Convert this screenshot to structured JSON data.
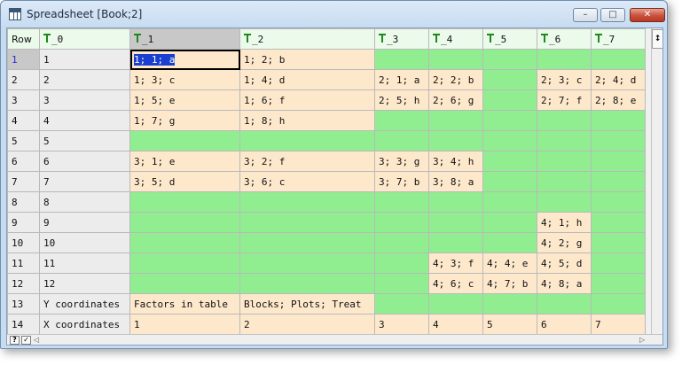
{
  "window": {
    "title": "Spreadsheet [Book;2]",
    "controls": {
      "minimize": "–",
      "maximize": "□",
      "close": "✕"
    }
  },
  "grid": {
    "corner_label": "Row",
    "columns": [
      "_0",
      "_1",
      "_2",
      "_3",
      "_4",
      "_5",
      "_6",
      "_7"
    ],
    "rows": [
      [
        "1",
        "1",
        "1; 1; a",
        "1; 2; b",
        "",
        "",
        "",
        "",
        ""
      ],
      [
        "2",
        "2",
        "1; 3; c",
        "1; 4; d",
        "2; 1; a",
        "2; 2; b",
        "",
        "2; 3; c",
        "2; 4; d"
      ],
      [
        "3",
        "3",
        "1; 5; e",
        "1; 6; f",
        "2; 5; h",
        "2; 6; g",
        "",
        "2; 7; f",
        "2; 8; e"
      ],
      [
        "4",
        "4",
        "1; 7; g",
        "1; 8; h",
        "",
        "",
        "",
        "",
        ""
      ],
      [
        "5",
        "5",
        "",
        "",
        "",
        "",
        "",
        "",
        ""
      ],
      [
        "6",
        "6",
        "3; 1; e",
        "3; 2; f",
        "3; 3; g",
        "3; 4; h",
        "",
        "",
        ""
      ],
      [
        "7",
        "7",
        "3; 5; d",
        "3; 6; c",
        "3; 7; b",
        "3; 8; a",
        "",
        "",
        ""
      ],
      [
        "8",
        "8",
        "",
        "",
        "",
        "",
        "",
        "",
        ""
      ],
      [
        "9",
        "9",
        "",
        "",
        "",
        "",
        "",
        "4; 1; h",
        ""
      ],
      [
        "10",
        "10",
        "",
        "",
        "",
        "",
        "",
        "4; 2; g",
        ""
      ],
      [
        "11",
        "11",
        "",
        "",
        "",
        "4; 3; f",
        "4; 4; e",
        "4; 5; d",
        ""
      ],
      [
        "12",
        "12",
        "",
        "",
        "",
        "4; 6; c",
        "4; 7; b",
        "4; 8; a",
        ""
      ],
      [
        "13",
        "Y coordinates",
        "Factors in table",
        "Blocks; Plots; Treat",
        "",
        "",
        "",
        "",
        ""
      ],
      [
        "14",
        "X coordinates",
        "1",
        "2",
        "3",
        "4",
        "5",
        "6",
        "7"
      ]
    ],
    "selected_row": 1,
    "selected_column": "_1",
    "active_cell": "1; 1; a"
  },
  "scrollbars": {
    "vertical_glyph": "↕",
    "help_button": "?",
    "check_button": "✓",
    "left_arrow": "◁",
    "right_arrow": "▷"
  },
  "colors": {
    "empty_cell": "#90ee90",
    "filled_cell": "#fde8cc",
    "header": "#ebfaeb",
    "selection": "#1a3fd0"
  }
}
